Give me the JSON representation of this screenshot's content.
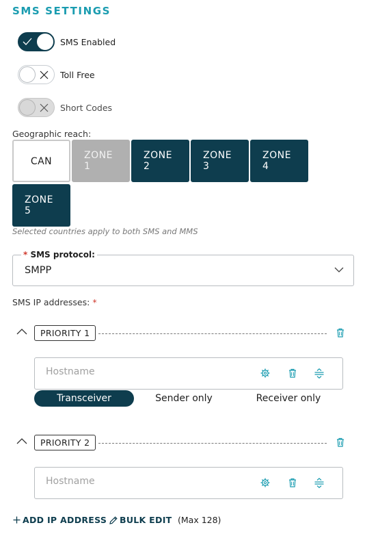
{
  "title": "SMS SETTINGS",
  "toggles": [
    {
      "label": "SMS Enabled",
      "state": "on"
    },
    {
      "label": "Toll Free",
      "state": "off"
    },
    {
      "label": "Short Codes",
      "state": "disabled"
    }
  ],
  "geo": {
    "label": "Geographic reach:",
    "zones": [
      {
        "line1": "CAN",
        "line2": ""
      },
      {
        "line1": "ZONE",
        "line2": "1"
      },
      {
        "line1": "ZONE",
        "line2": "2"
      },
      {
        "line1": "ZONE",
        "line2": "3"
      },
      {
        "line1": "ZONE",
        "line2": "4"
      },
      {
        "line1": "ZONE",
        "line2": "5"
      }
    ],
    "hint": "Selected countries apply to both SMS and MMS"
  },
  "protocol": {
    "required": "*",
    "label": "SMS protocol:",
    "value": "SMPP"
  },
  "ip": {
    "label": "SMS IP addresses:",
    "required": "*",
    "priorities": [
      {
        "label": "PRIORITY 1",
        "placeholder": "Hostname",
        "value": ""
      },
      {
        "label": "PRIORITY 2",
        "placeholder": "Hostname",
        "value": ""
      }
    ],
    "modes": [
      "Transceiver",
      "Sender only",
      "Receiver only"
    ],
    "active_mode": "Transceiver"
  },
  "actions": {
    "add": "ADD IP ADDRESS",
    "bulk": "BULK EDIT",
    "max": "(Max 128)"
  },
  "colors": {
    "accent": "#1a9cb0",
    "primary": "#0e3d4e",
    "required": "#d03a2e",
    "disabled": "#b0b0b0"
  }
}
